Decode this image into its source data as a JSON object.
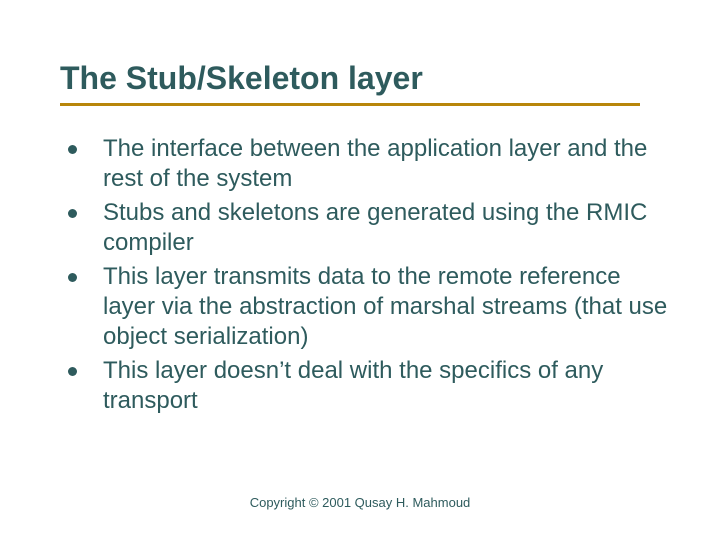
{
  "slide": {
    "title": "The Stub/Skeleton layer",
    "bullets": [
      "The interface between the application layer and the rest of the system",
      "Stubs and skeletons are generated using the RMIC compiler",
      "This layer transmits data to the remote reference layer via the abstraction of marshal streams (that use object serialization)",
      "This layer doesn’t deal with the specifics of any transport"
    ],
    "footer": "Copyright © 2001 Qusay H. Mahmoud"
  }
}
